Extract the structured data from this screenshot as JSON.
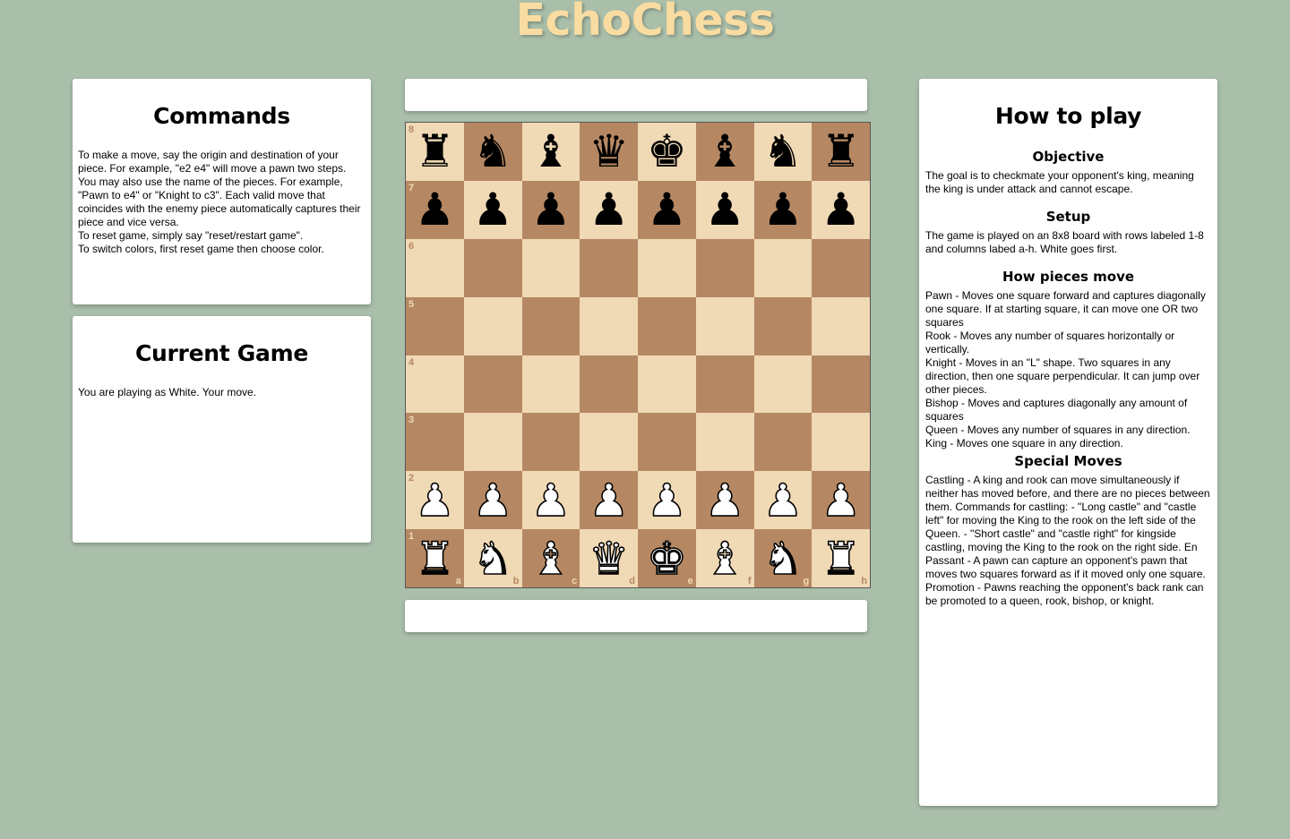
{
  "app": {
    "title": "EchoChess"
  },
  "commands": {
    "title": "Commands",
    "lines": [
      "To make a move, say the origin and destination of your piece. For example, \"e2 e4\" will move a pawn two steps. You may also use the name of the pieces. For example, \"Pawn to e4\" or \"Knight to c3\". Each valid move that coincides with the enemy piece automatically captures their piece and vice versa.",
      "To reset game, simply say \"reset/restart game\".",
      "To switch colors, first reset game then choose color."
    ]
  },
  "current_game": {
    "title": "Current Game",
    "status": "You are playing as White. Your move."
  },
  "status_bar_top": {
    "text": ""
  },
  "status_bar_bottom": {
    "text": ""
  },
  "board": {
    "colors": {
      "light": "#f0d9b5",
      "dark": "#b58863"
    },
    "ranks": [
      "8",
      "7",
      "6",
      "5",
      "4",
      "3",
      "2",
      "1"
    ],
    "files": [
      "a",
      "b",
      "c",
      "d",
      "e",
      "f",
      "g",
      "h"
    ],
    "position": [
      [
        "r",
        "n",
        "b",
        "q",
        "k",
        "b",
        "n",
        "r"
      ],
      [
        "p",
        "p",
        "p",
        "p",
        "p",
        "p",
        "p",
        "p"
      ],
      [
        "",
        "",
        "",
        "",
        "",
        "",
        "",
        ""
      ],
      [
        "",
        "",
        "",
        "",
        "",
        "",
        "",
        ""
      ],
      [
        "",
        "",
        "",
        "",
        "",
        "",
        "",
        ""
      ],
      [
        "",
        "",
        "",
        "",
        "",
        "",
        "",
        ""
      ],
      [
        "P",
        "P",
        "P",
        "P",
        "P",
        "P",
        "P",
        "P"
      ],
      [
        "R",
        "N",
        "B",
        "Q",
        "K",
        "B",
        "N",
        "R"
      ]
    ]
  },
  "how_to_play": {
    "title": "How to play",
    "objective": {
      "heading": "Objective",
      "text": "The goal is to checkmate your opponent's king, meaning the king is under attack and cannot escape."
    },
    "setup": {
      "heading": "Setup",
      "text": "The game is played on an 8x8 board with rows labeled 1-8 and columns labed a-h. White goes first."
    },
    "pieces": {
      "heading": "How pieces move",
      "lines": [
        "Pawn - Moves one square forward and captures diagonally one square. If at starting square, it can move one OR two squares",
        "Rook - Moves any number of squares horizontally or vertically.",
        "Knight - Moves in an \"L\" shape. Two squares in any direction, then one square perpendicular. It can jump over other pieces.",
        "Bishop - Moves and captures diagonally any amount of squares",
        "Queen - Moves any number of squares in any direction.",
        "King - Moves one square in any direction."
      ]
    },
    "special": {
      "heading": "Special Moves",
      "lines": [
        "Castling - A king and rook can move simultaneously if neither has moved before, and there are no pieces between them. Commands for castling: - \"Long castle\" and \"castle left\" for moving the King to the rook on the left side of the Queen. - \"Short castle\" and \"castle right\" for kingside castling, moving the King to the rook on the right side. En Passant - A pawn can capture an opponent's pawn that moves two squares forward as if it moved only one square.",
        "Promotion - Pawns reaching the opponent's back rank can be promoted to a queen, rook, bishop, or knight."
      ]
    }
  }
}
